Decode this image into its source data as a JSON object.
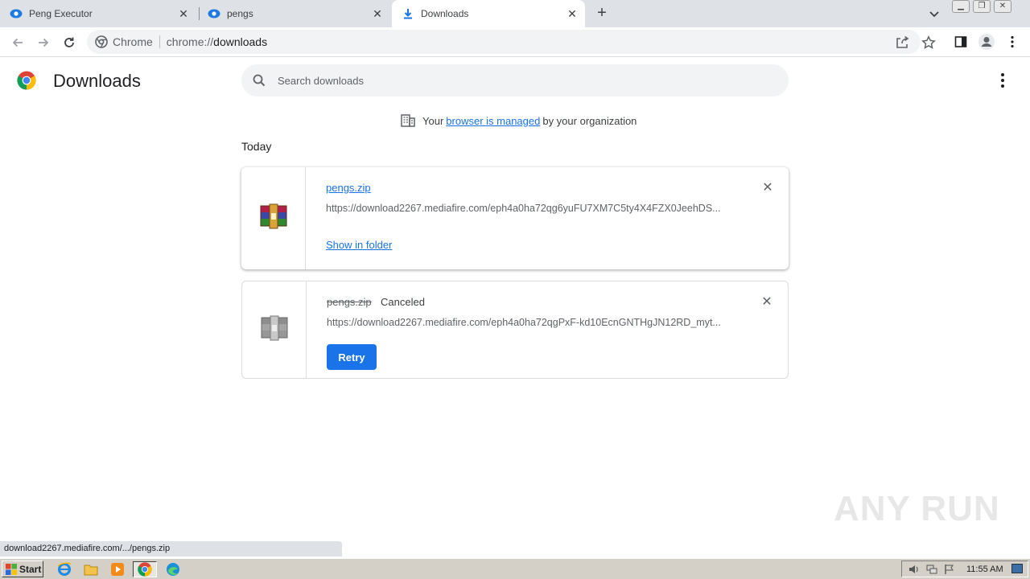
{
  "tabs": [
    {
      "title": "Peng Executor",
      "active": false
    },
    {
      "title": "pengs",
      "active": false
    },
    {
      "title": "Downloads",
      "active": true
    }
  ],
  "toolbar": {
    "site_label": "Chrome",
    "url_scheme": "chrome://",
    "url_host": "downloads"
  },
  "page": {
    "title": "Downloads",
    "search_placeholder": "Search downloads",
    "managed_prefix": "Your",
    "managed_link": "browser is managed",
    "managed_suffix": "by your organization",
    "date_header": "Today"
  },
  "downloads": [
    {
      "filename": "pengs.zip",
      "status": "",
      "url": "https://download2267.mediafire.com/eph4a0ha72qg6yuFU7XM7C5ty4X4FZX0JeehDS...",
      "action": "Show in folder",
      "state": "complete"
    },
    {
      "filename": "pengs.zip",
      "status": "Canceled",
      "url": "https://download2267.mediafire.com/eph4a0ha72qgPxF-kd10EcnGNTHgJN12RD_myt...",
      "action": "Retry",
      "state": "canceled"
    }
  ],
  "status_bubble": "download2267.mediafire.com/.../pengs.zip",
  "watermark": "ANY RUN",
  "taskbar": {
    "start_label": "Start",
    "clock": "11:55 AM"
  },
  "colors": {
    "accent": "#1a73e8",
    "tabstrip": "#dee1e6",
    "taskbar": "#d4d0c8"
  }
}
